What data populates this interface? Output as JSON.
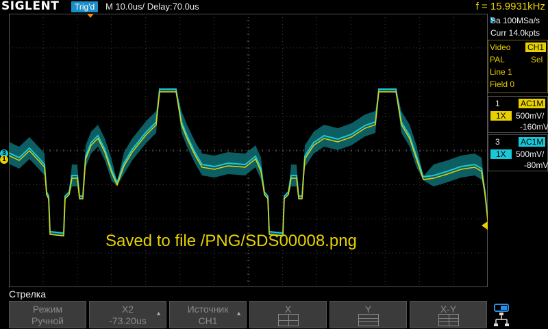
{
  "header": {
    "brand": "SIGLENT",
    "trigger_status": "Trig'd",
    "timebase": "M 10.0us/",
    "delay": "Delay:70.0us",
    "frequency": "f = 15.9931kHz"
  },
  "acquisition": {
    "sample_rate": "Sa 100MSa/s",
    "memory_depth": "Curr 14.0kpts"
  },
  "trigger": {
    "type": "Video",
    "source": "CH1",
    "standard": "PAL",
    "mode": "Sel",
    "line": "Line 1",
    "field": "Field 0"
  },
  "channels": [
    {
      "number": "1",
      "coupling": "AC1M",
      "probe": "1X",
      "scale": "500mV/",
      "offset": "-160mV",
      "color": "#e8d000"
    },
    {
      "number": "3",
      "coupling": "AC1M",
      "probe": "1X",
      "scale": "500mV/",
      "offset": "-80mV",
      "color": "#19c8d8"
    }
  ],
  "message": "Saved to file /PNG/SDS00008.png",
  "menu": {
    "title": "Стрелка",
    "softkeys": [
      {
        "line1": "Режим",
        "line2": "Ручной"
      },
      {
        "line1": "X2",
        "line2": "-73.20us"
      },
      {
        "line1": "Источник",
        "line2": "CH1"
      },
      {
        "line1": "X",
        "line2": ""
      },
      {
        "line1": "Y",
        "line2": ""
      },
      {
        "line1": "X-Y",
        "line2": ""
      }
    ]
  },
  "markers": {
    "ch1": "1",
    "ch3": "3"
  },
  "icons": {
    "trigger_level": "triangle-left-icon",
    "trigger_position": "triangle-down-icon",
    "network": "network-icon",
    "usb": "usb-icon"
  }
}
